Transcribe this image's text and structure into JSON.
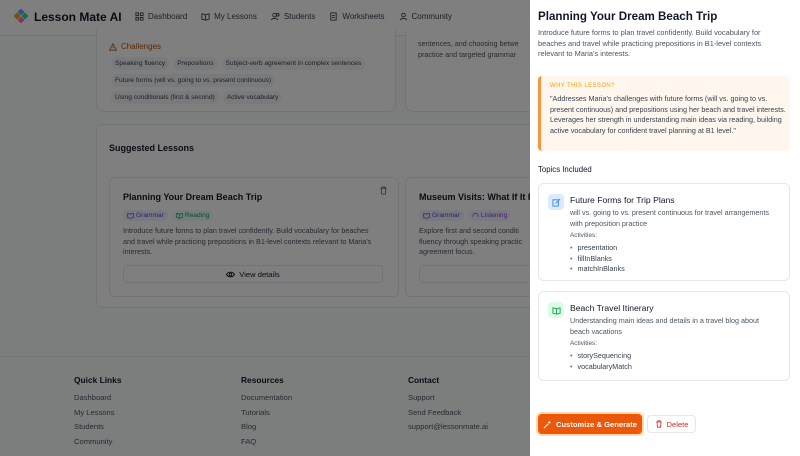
{
  "app": {
    "brand": "Lesson Mate AI",
    "nav": [
      {
        "label": "Dashboard",
        "icon": "grid-icon"
      },
      {
        "label": "My Lessons",
        "icon": "book-icon"
      },
      {
        "label": "Students",
        "icon": "users-icon"
      },
      {
        "label": "Worksheets",
        "icon": "document-icon"
      },
      {
        "label": "Community",
        "icon": "user-icon"
      }
    ]
  },
  "challenges": {
    "title": "Challenges",
    "items": [
      "Speaking fluency",
      "Prepositions",
      "Subject-verb agreement in complex sentences",
      "Future forms (will vs. going to vs. present continuous)",
      "Using conditionals (first & second)",
      "Active vocabulary"
    ]
  },
  "partial_card": {
    "lines": [
      "sentences, and choosing betwe",
      "practice and targeted grammar"
    ]
  },
  "suggested": {
    "title": "Suggested Lessons",
    "lessons": [
      {
        "title": "Planning Your Dream Beach Trip",
        "tags": [
          "Grammar",
          "Reading"
        ],
        "description": "Introduce future forms to plan travel confidently. Build vocabulary for beaches and travel while practicing prepositions in B1-level contexts relevant to Maria's interests.",
        "button": "View details"
      },
      {
        "title": "Museum Visits: What If It Ra",
        "tags": [
          "Grammar",
          "Listening"
        ],
        "description": "Explore first and second conditi fluency through speaking practic agreement focus.",
        "button": ""
      }
    ]
  },
  "footer": {
    "columns": [
      {
        "heading": "Quick Links",
        "links": [
          "Dashboard",
          "My Lessons",
          "Students",
          "Community"
        ]
      },
      {
        "heading": "Resources",
        "links": [
          "Documentation",
          "Tutorials",
          "Blog",
          "FAQ"
        ]
      },
      {
        "heading": "Contact",
        "links": [
          "Support",
          "Send Feedback",
          "support@lessonmate.ai"
        ]
      }
    ]
  },
  "drawer": {
    "title": "Planning Your Dream Beach Trip",
    "description": "Introduce future forms to plan travel confidently. Build vocabulary for beaches and travel while practicing prepositions in B1-level contexts relevant to Maria's interests.",
    "why_heading": "WHY THIS LESSON?",
    "why_text": "\"Addresses Maria's challenges with future forms (will vs. going to vs. present continuous) and prepositions using her beach and travel interests. Leverages her strength in understanding main ideas via reading, building active vocabulary for confident travel planning at B1 level.\"",
    "topics_heading": "Topics Included",
    "topics": [
      {
        "title": "Future Forms for Trip Plans",
        "description": "will vs. going to vs. present continuous for travel arrangements with preposition practice",
        "activities_label": "Activities:",
        "activities": [
          "presentation",
          "fillInBlanks",
          "matchInBlanks"
        ]
      },
      {
        "title": "Beach Travel Itinerary",
        "description": "Understanding main ideas and details in a travel blog about beach vacations",
        "activities_label": "Activities:",
        "activities": [
          "storySequencing",
          "vocabularyMatch"
        ]
      }
    ],
    "generate_button": "Customize & Generate",
    "delete_button": "Delete"
  },
  "colors": {
    "accent": "#ea580c",
    "why_bg": "#fff7ed",
    "danger": "#dc2626"
  }
}
